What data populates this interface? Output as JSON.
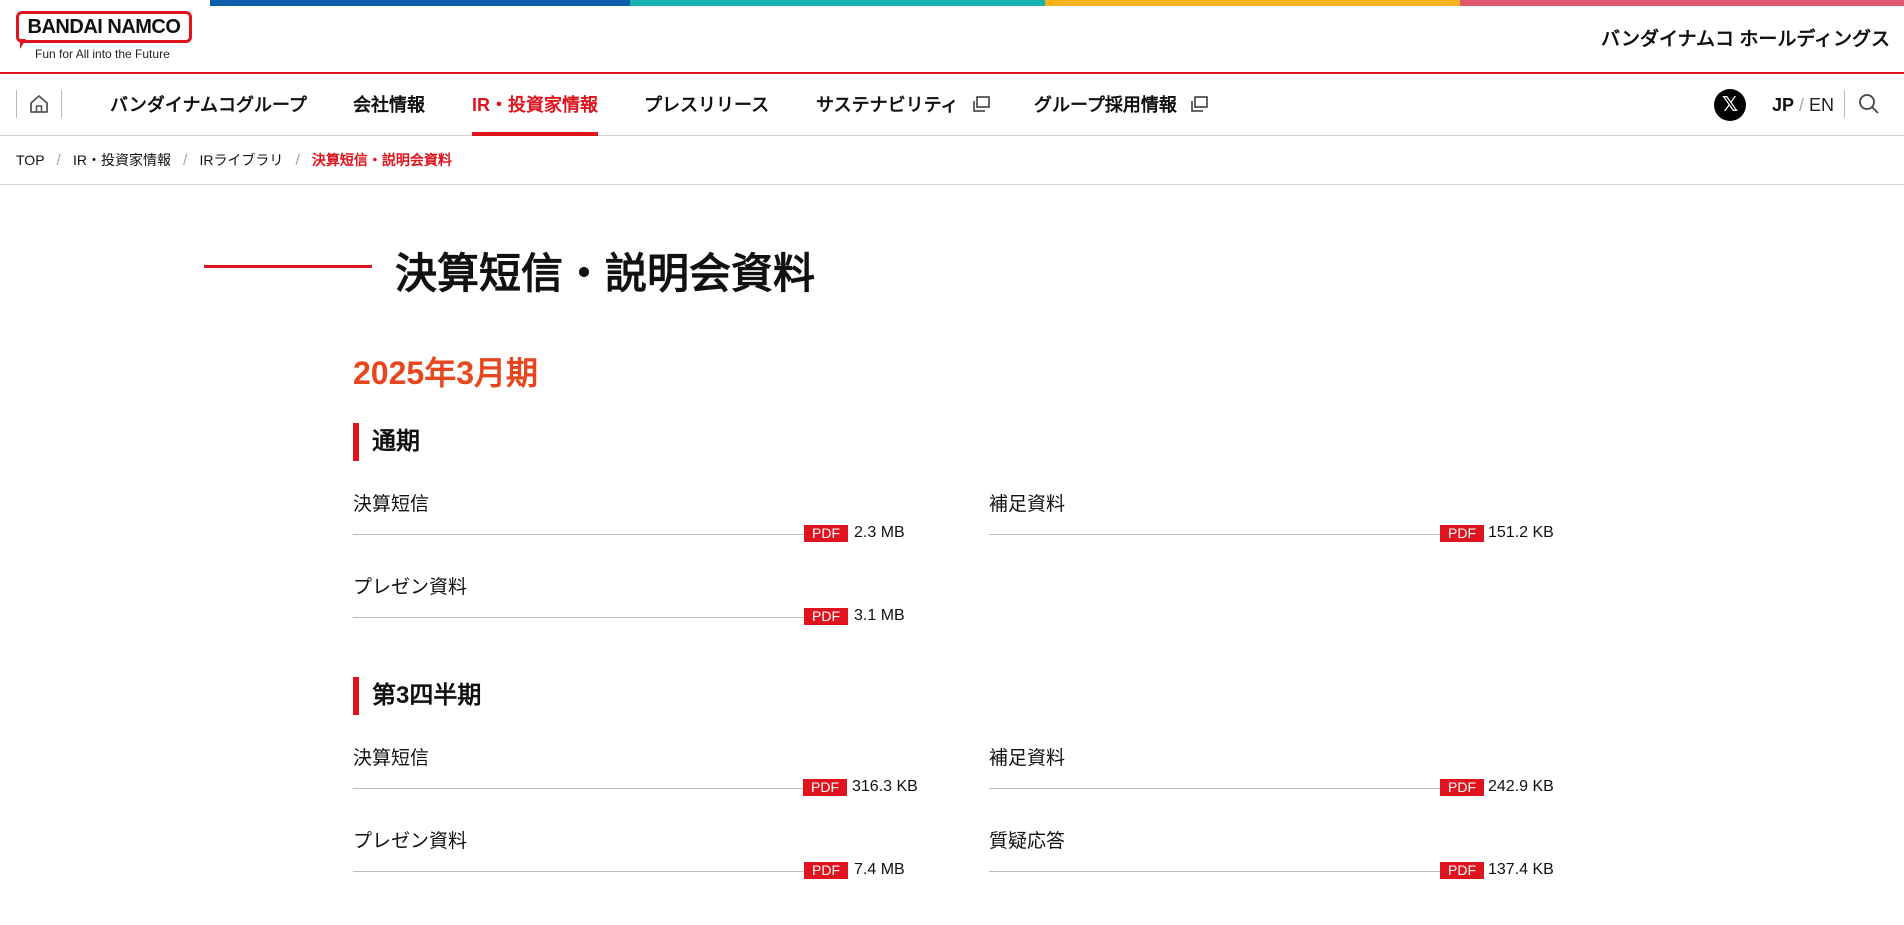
{
  "header": {
    "logo_text": "BANDAI NAMCO",
    "logo_tagline": "Fun for All into the Future",
    "company_name": "バンダイナムコ ホールディングス",
    "brand_colors": [
      "#0d5ea8",
      "#17b3b0",
      "#f5b21a",
      "#e0596f"
    ],
    "accent": "#e0141e"
  },
  "nav": {
    "items": [
      {
        "label": "バンダイナムコグループ",
        "active": false,
        "external": false
      },
      {
        "label": "会社情報",
        "active": false,
        "external": false
      },
      {
        "label": "IR・投資家情報",
        "active": true,
        "external": false
      },
      {
        "label": "プレスリリース",
        "active": false,
        "external": false
      },
      {
        "label": "サステナビリティ",
        "active": false,
        "external": true
      },
      {
        "label": "グループ採用情報",
        "active": false,
        "external": true
      }
    ],
    "lang_jp": "JP",
    "lang_sep": "/",
    "lang_en": "EN",
    "x_icon": "x-logo-icon"
  },
  "breadcrumb": [
    "TOP",
    "IR・投資家情報",
    "IRライブラリ",
    "決算短信・説明会資料"
  ],
  "page_title": "決算短信・説明会資料",
  "period": "2025年3月期",
  "sections": [
    {
      "title": "通期",
      "docs": [
        {
          "label": "決算短信",
          "badge": "PDF",
          "size": "2.3 MB"
        },
        {
          "label": "補足資料",
          "badge": "PDF",
          "size": "151.2 KB"
        },
        {
          "label": "プレゼン資料",
          "badge": "PDF",
          "size": "3.1 MB"
        }
      ]
    },
    {
      "title": "第3四半期",
      "docs": [
        {
          "label": "決算短信",
          "badge": "PDF",
          "size": "316.3 KB"
        },
        {
          "label": "補足資料",
          "badge": "PDF",
          "size": "242.9 KB"
        },
        {
          "label": "プレゼン資料",
          "badge": "PDF",
          "size": "7.4 MB"
        },
        {
          "label": "質疑応答",
          "badge": "PDF",
          "size": "137.4 KB"
        }
      ]
    }
  ]
}
